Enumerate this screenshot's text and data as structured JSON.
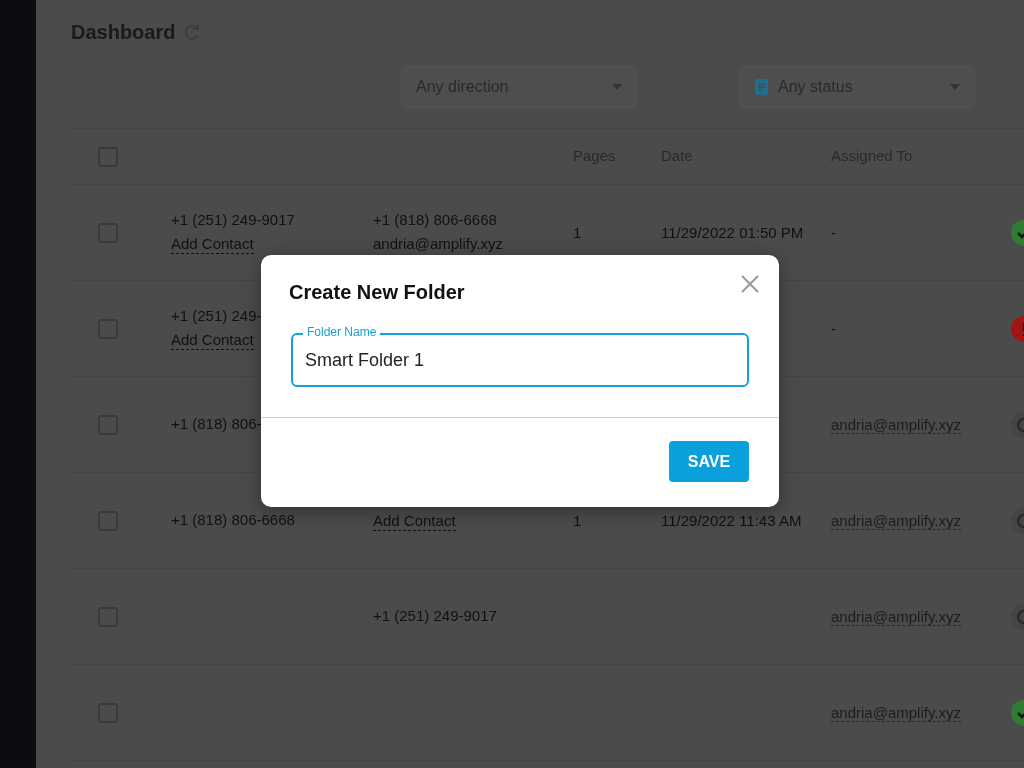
{
  "page": {
    "title": "Dashboard"
  },
  "filters": [
    {
      "kind": "direction",
      "label": "Any direction"
    },
    {
      "kind": "status",
      "label": "Any status"
    }
  ],
  "table": {
    "header": {
      "select_all_checked": false,
      "pages": "Pages",
      "date": "Date",
      "assigned": "Assigned To"
    },
    "rows": [
      {
        "checked": false,
        "from": "+1 (251) 249-9017",
        "from_sub": "Add Contact",
        "to": "+1 (818) 806-6668",
        "to_sub": "andria@amplify.xyz",
        "pages": "1",
        "date": "11/29/2022 01:50 PM",
        "assigned": "-",
        "status": {
          "kind": "success"
        }
      },
      {
        "checked": false,
        "from": "+1 (251) 249-",
        "from_sub": "Add Contact",
        "assigned": "-",
        "status": {
          "kind": "error"
        }
      },
      {
        "checked": false,
        "from": "+1 (818) 806-",
        "assigned": "andria@amplify.xyz",
        "status": {
          "kind": "pending"
        }
      },
      {
        "checked": false,
        "from": "+1 (818) 806-6668",
        "to_sub": "Add Contact",
        "pages": "1",
        "date": "11/29/2022 11:43 AM",
        "assigned": "andria@amplify.xyz",
        "status": {
          "kind": "pending"
        }
      },
      {
        "checked": false,
        "to": "+1 (251) 249-9017",
        "assigned": "andria@amplify.xyz",
        "status": {
          "kind": "pending"
        }
      },
      {
        "checked": false,
        "assigned": "andria@amplify.xyz",
        "status": {
          "kind": "success"
        }
      }
    ]
  },
  "dialog": {
    "title": "Create New Folder",
    "field": {
      "label": "Folder Name",
      "value": "Smart Folder 1"
    },
    "buttons": [
      {
        "label": "SAVE"
      }
    ]
  }
}
